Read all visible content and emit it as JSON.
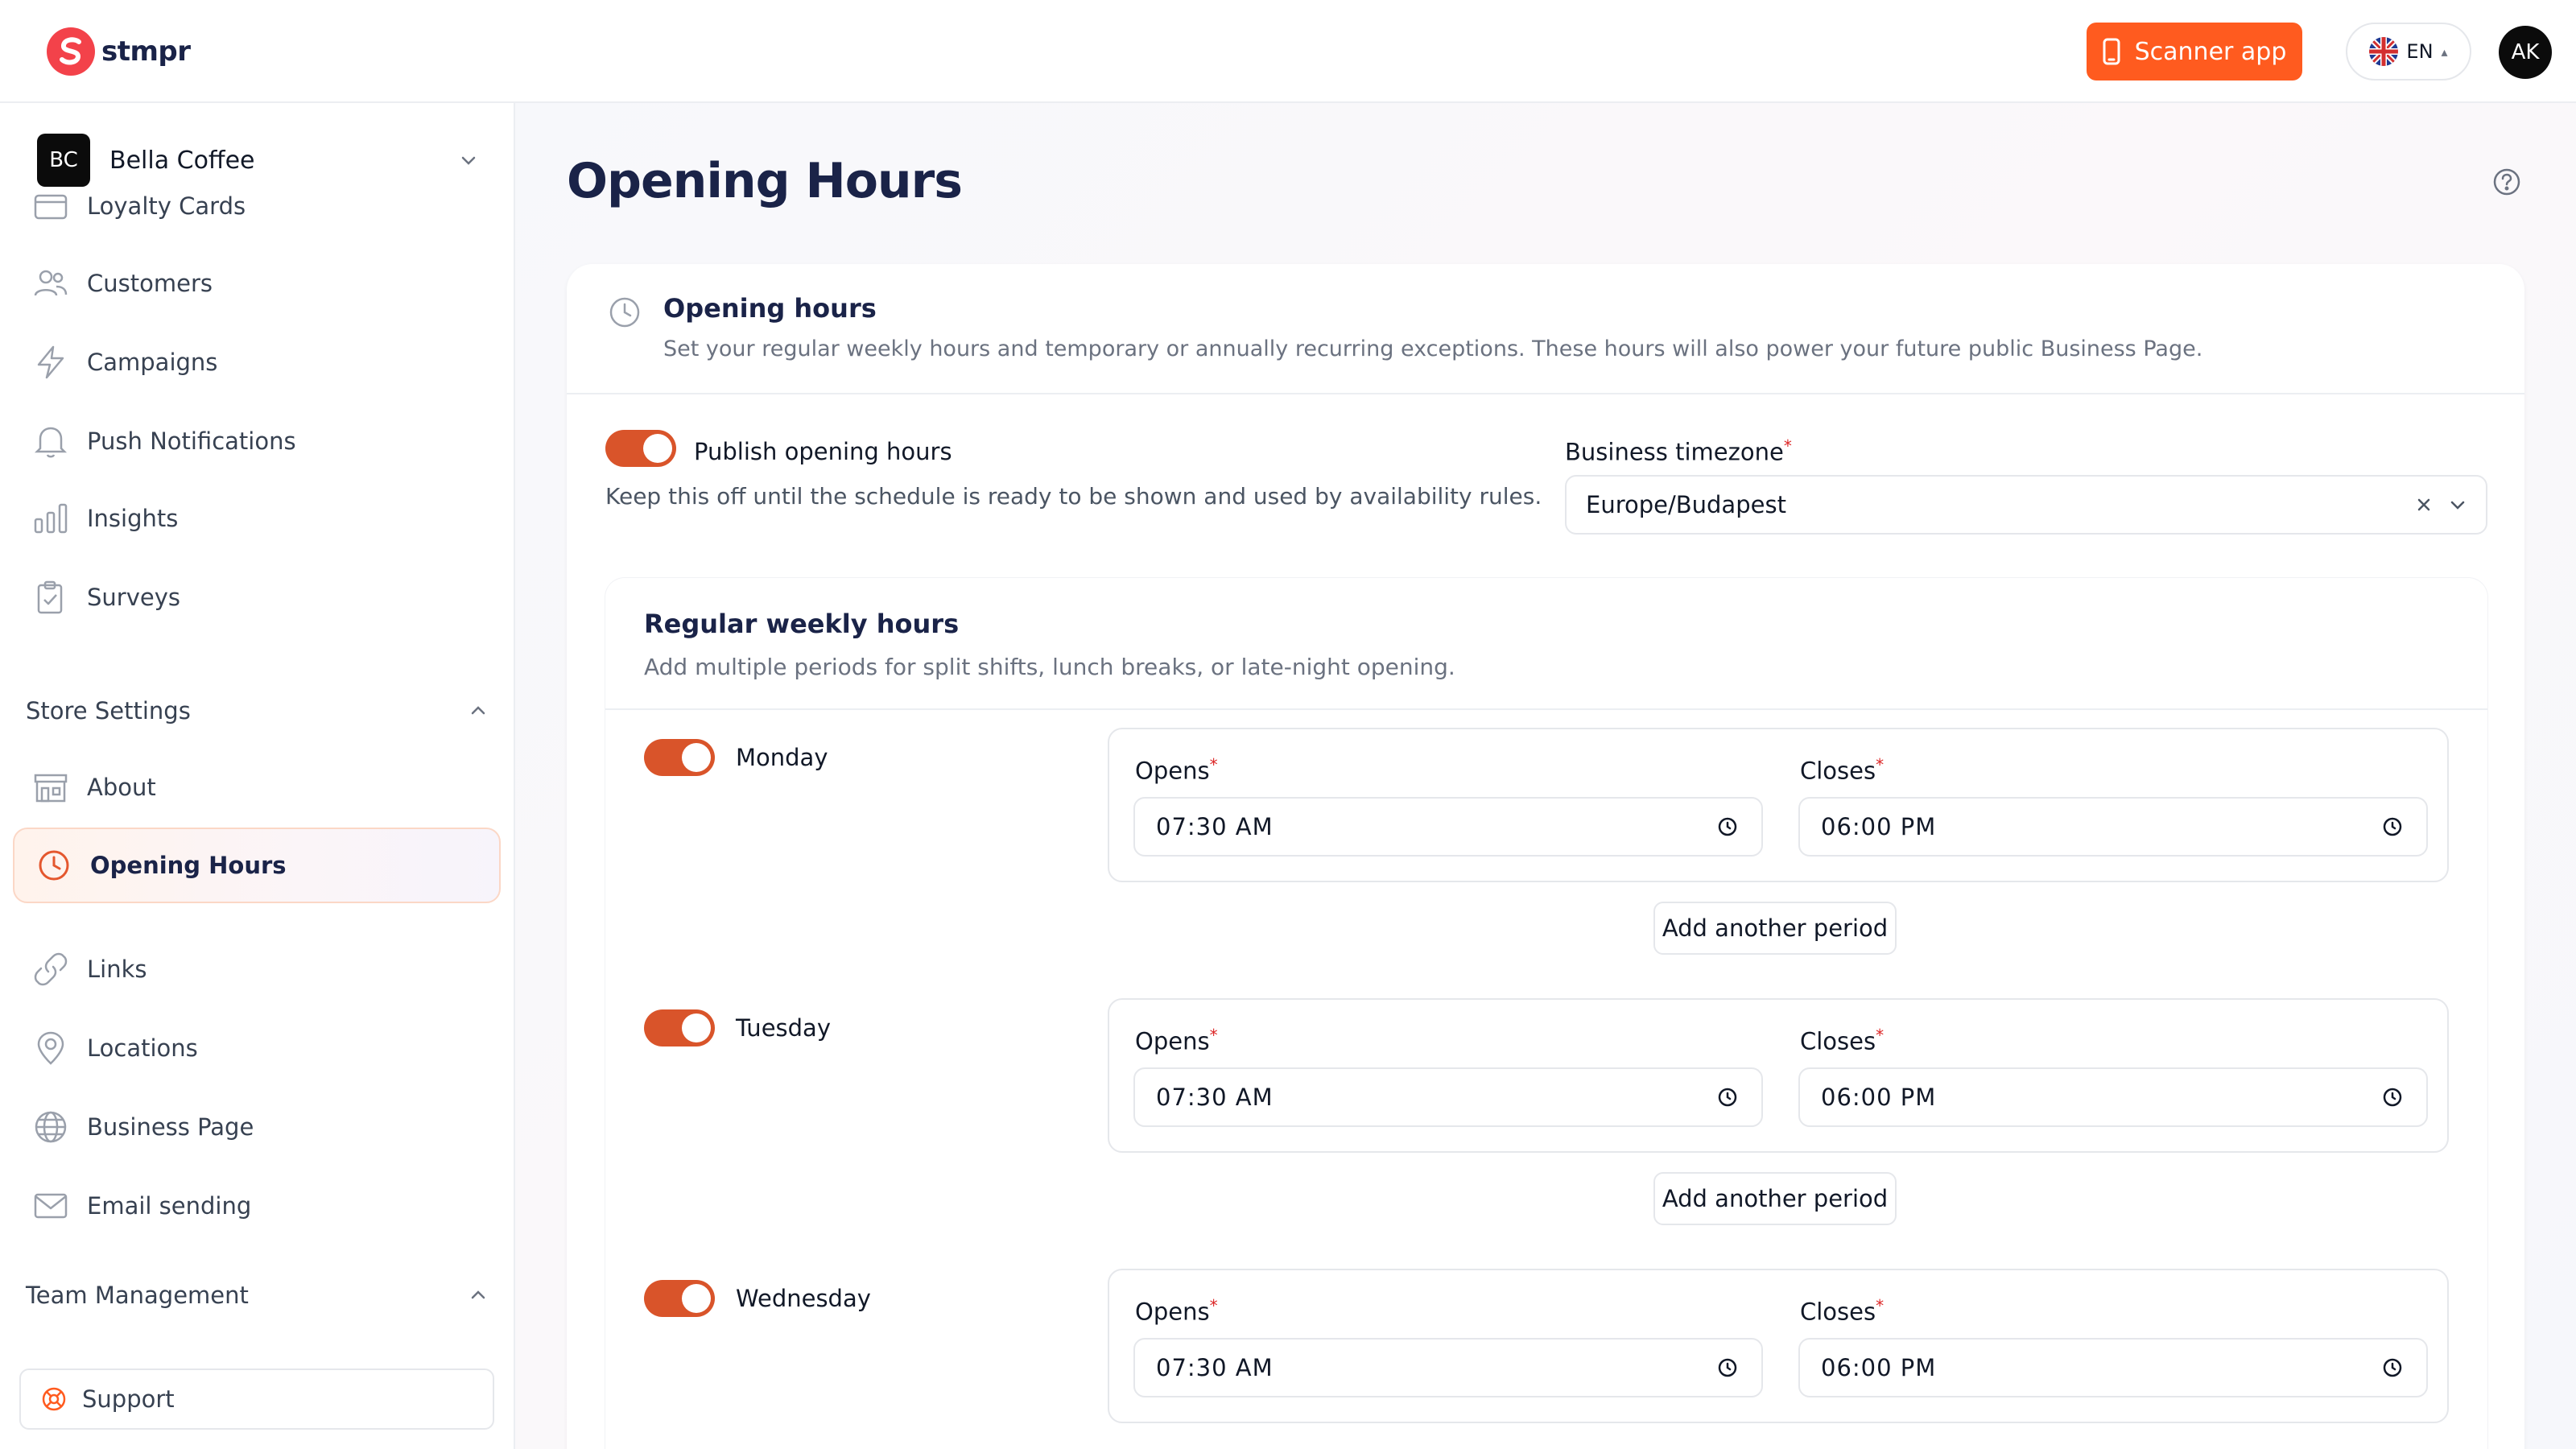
{
  "app": {
    "name": "stmpr"
  },
  "header": {
    "scanner_label": "Scanner app",
    "language": "EN",
    "user_initials": "AK"
  },
  "sidebar": {
    "store": {
      "initials": "BC",
      "name": "Bella Coffee"
    },
    "items": [
      {
        "label": "Loyalty Cards",
        "icon": "card-icon"
      },
      {
        "label": "Customers",
        "icon": "users-icon"
      },
      {
        "label": "Campaigns",
        "icon": "bolt-icon"
      },
      {
        "label": "Push Notifications",
        "icon": "bell-icon"
      },
      {
        "label": "Insights",
        "icon": "bar-chart-icon"
      },
      {
        "label": "Surveys",
        "icon": "clipboard-icon"
      }
    ],
    "store_settings": {
      "title": "Store Settings",
      "items": [
        {
          "label": "About",
          "icon": "store-icon"
        },
        {
          "label": "Opening Hours",
          "icon": "clock-icon",
          "active": true
        },
        {
          "label": "Links",
          "icon": "link-icon"
        },
        {
          "label": "Locations",
          "icon": "map-pin-icon"
        },
        {
          "label": "Business Page",
          "icon": "globe-icon"
        },
        {
          "label": "Email sending",
          "icon": "mail-icon"
        }
      ]
    },
    "team_management": {
      "title": "Team Management"
    },
    "support_label": "Support"
  },
  "main": {
    "page_title": "Opening Hours",
    "card": {
      "title": "Opening hours",
      "subtitle": "Set your regular weekly hours and temporary or annually recurring exceptions. These hours will also power your future public Business Page.",
      "publish": {
        "label": "Publish opening hours",
        "help": "Keep this off until the schedule is ready to be shown and used by availability rules.",
        "enabled": true
      },
      "timezone": {
        "label": "Business timezone",
        "value": "Europe/Budapest"
      }
    },
    "weekly": {
      "title": "Regular weekly hours",
      "subtitle": "Add multiple periods for split shifts, lunch breaks, or late-night opening.",
      "opens_label": "Opens",
      "closes_label": "Closes",
      "add_period_label": "Add another period",
      "days": [
        {
          "name": "Monday",
          "enabled": true,
          "opens": "07:30 AM",
          "closes": "06:00 PM"
        },
        {
          "name": "Tuesday",
          "enabled": true,
          "opens": "07:30 AM",
          "closes": "06:00 PM"
        },
        {
          "name": "Wednesday",
          "enabled": true,
          "opens": "07:30 AM",
          "closes": "06:00 PM"
        }
      ]
    }
  },
  "colors": {
    "accent": "#ff5b1f",
    "toggle_on": "#d9542a",
    "title": "#1a2348",
    "required": "#dc2626"
  }
}
